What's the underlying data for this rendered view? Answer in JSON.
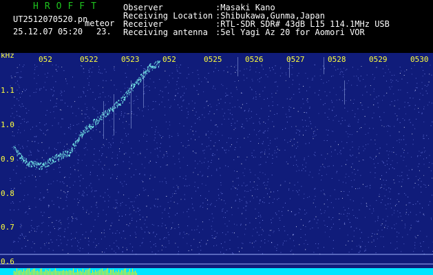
{
  "header": {
    "brand": "HROFFT",
    "filename": "UT2512070520.pn",
    "tag": "meteor",
    "datetime": "25.12.07 05:20",
    "sub_value": "23.",
    "info_labels": [
      "Observer",
      "Receiving Location",
      "Receiver",
      "Receiving antenna"
    ],
    "info_values": [
      ":Masaki Kano",
      ":Shibukawa,Gunma,Japan",
      ":RTL-SDR SDR# 43dB L15 114.1MHz USB",
      ":5el Yagi Az 20 for Aomori VOR"
    ]
  },
  "axes": {
    "y_unit": "kHz",
    "y_ticks": [
      "1.1",
      "1.0",
      "0.9",
      "0.8",
      "0.7",
      "0.6"
    ],
    "x_ticks": [
      "052",
      "0522",
      "0523",
      "052",
      "0525",
      "0526",
      "0527",
      "0528",
      "0529",
      "0530"
    ]
  },
  "colors": {
    "background": "#101c7a",
    "noise": "#6f7fe6",
    "echo": "#7cf6f0",
    "text": "#ffff3c",
    "bottom_bar": "#00e5ff",
    "bottom_signal": "#ffee00"
  }
}
